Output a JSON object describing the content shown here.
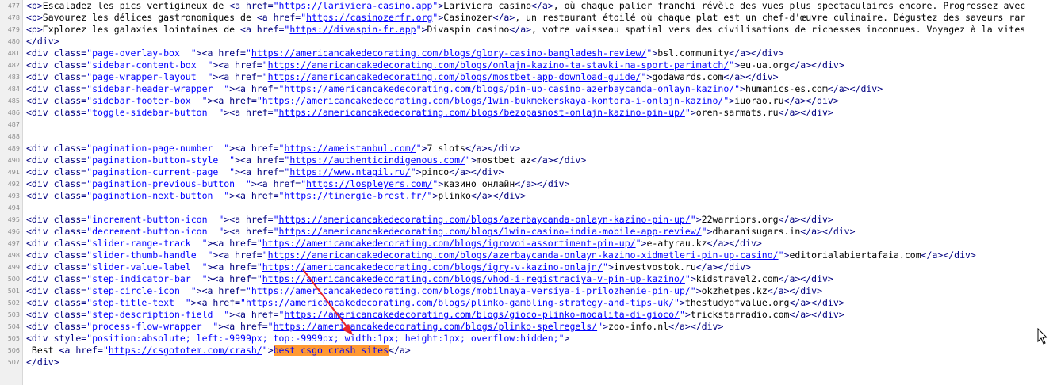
{
  "colors": {
    "tag": "#000080",
    "value": "#0000ff",
    "highlight": "#ff9933",
    "arrow": "#e8242a"
  },
  "lines": [
    {
      "n": "477",
      "segs": [
        [
          "t",
          "<p>"
        ],
        [
          "p",
          "Escaladez les pics vertigineux de "
        ],
        [
          "t",
          "<a href="
        ],
        [
          "v",
          "\""
        ],
        [
          "u",
          "https://lariviera-casino.app"
        ],
        [
          "v",
          "\""
        ],
        [
          "t",
          ">"
        ],
        [
          "p",
          "Lariviera casino"
        ],
        [
          "t",
          "</a>"
        ],
        [
          "p",
          ", où chaque palier franchi révèle des vues plus spectaculaires encore. Progressez avec"
        ]
      ]
    },
    {
      "n": "478",
      "segs": [
        [
          "t",
          "<p>"
        ],
        [
          "p",
          "Savourez les délices gastronomiques de "
        ],
        [
          "t",
          "<a href="
        ],
        [
          "v",
          "\""
        ],
        [
          "u",
          "https://casinozerfr.org"
        ],
        [
          "v",
          "\""
        ],
        [
          "t",
          ">"
        ],
        [
          "p",
          "Casinozer"
        ],
        [
          "t",
          "</a>"
        ],
        [
          "p",
          ", un restaurant étoilé où chaque plat est un chef-d'œuvre culinaire. Dégustez des saveurs rar"
        ]
      ]
    },
    {
      "n": "479",
      "segs": [
        [
          "t",
          "<p>"
        ],
        [
          "p",
          "Explorez les galaxies lointaines de "
        ],
        [
          "t",
          "<a href="
        ],
        [
          "v",
          "\""
        ],
        [
          "u",
          "https://divaspin-fr.app"
        ],
        [
          "v",
          "\""
        ],
        [
          "t",
          ">"
        ],
        [
          "p",
          "Divaspin casino"
        ],
        [
          "t",
          "</a>"
        ],
        [
          "p",
          ", votre vaisseau spatial vers des civilisations de richesses inconnues. Voyagez à la vites"
        ]
      ]
    },
    {
      "n": "480",
      "segs": [
        [
          "t",
          "</div>"
        ]
      ]
    },
    {
      "n": "481",
      "segs": [
        [
          "t",
          "<div "
        ],
        [
          "a",
          "class="
        ],
        [
          "v",
          "\"page-overlay-box  \""
        ],
        [
          "t",
          "><a href="
        ],
        [
          "v",
          "\""
        ],
        [
          "u",
          "https://americancakedecorating.com/blogs/glory-casino-bangladesh-review/"
        ],
        [
          "v",
          "\""
        ],
        [
          "t",
          ">"
        ],
        [
          "p",
          "bsl.community"
        ],
        [
          "t",
          "</a></div>"
        ]
      ]
    },
    {
      "n": "482",
      "segs": [
        [
          "t",
          "<div "
        ],
        [
          "a",
          "class="
        ],
        [
          "v",
          "\"sidebar-content-box  \""
        ],
        [
          "t",
          "><a href="
        ],
        [
          "v",
          "\""
        ],
        [
          "u",
          "https://americancakedecorating.com/blogs/onlajn-kazino-ta-stavki-na-sport-parimatch/"
        ],
        [
          "v",
          "\""
        ],
        [
          "t",
          ">"
        ],
        [
          "p",
          "eu-ua.org"
        ],
        [
          "t",
          "</a></div>"
        ]
      ]
    },
    {
      "n": "483",
      "segs": [
        [
          "t",
          "<div "
        ],
        [
          "a",
          "class="
        ],
        [
          "v",
          "\"page-wrapper-layout  \""
        ],
        [
          "t",
          "><a href="
        ],
        [
          "v",
          "\""
        ],
        [
          "u",
          "https://americancakedecorating.com/blogs/mostbet-app-download-guide/"
        ],
        [
          "v",
          "\""
        ],
        [
          "t",
          ">"
        ],
        [
          "p",
          "godawards.com"
        ],
        [
          "t",
          "</a></div>"
        ]
      ]
    },
    {
      "n": "484",
      "segs": [
        [
          "t",
          "<div "
        ],
        [
          "a",
          "class="
        ],
        [
          "v",
          "\"sidebar-header-wrapper  \""
        ],
        [
          "t",
          "><a href="
        ],
        [
          "v",
          "\""
        ],
        [
          "u",
          "https://americancakedecorating.com/blogs/pin-up-casino-azerbaycanda-onlayn-kazino/"
        ],
        [
          "v",
          "\""
        ],
        [
          "t",
          ">"
        ],
        [
          "p",
          "humanics-es.com"
        ],
        [
          "t",
          "</a></div>"
        ]
      ]
    },
    {
      "n": "485",
      "segs": [
        [
          "t",
          "<div "
        ],
        [
          "a",
          "class="
        ],
        [
          "v",
          "\"sidebar-footer-box  \""
        ],
        [
          "t",
          "><a href="
        ],
        [
          "v",
          "\""
        ],
        [
          "u",
          "https://americancakedecorating.com/blogs/1win-bukmekerskaya-kontora-i-onlajn-kazino/"
        ],
        [
          "v",
          "\""
        ],
        [
          "t",
          ">"
        ],
        [
          "p",
          "iuorao.ru"
        ],
        [
          "t",
          "</a></div>"
        ]
      ]
    },
    {
      "n": "486",
      "segs": [
        [
          "t",
          "<div "
        ],
        [
          "a",
          "class="
        ],
        [
          "v",
          "\"toggle-sidebar-button  \""
        ],
        [
          "t",
          "><a href="
        ],
        [
          "v",
          "\""
        ],
        [
          "u",
          "https://americancakedecorating.com/blogs/bezopasnost-onlajn-kazino-pin-up/"
        ],
        [
          "v",
          "\""
        ],
        [
          "t",
          ">"
        ],
        [
          "p",
          "oren-sarmats.ru"
        ],
        [
          "t",
          "</a></div>"
        ]
      ]
    },
    {
      "n": "487",
      "segs": []
    },
    {
      "n": "488",
      "segs": []
    },
    {
      "n": "489",
      "segs": [
        [
          "t",
          "<div "
        ],
        [
          "a",
          "class="
        ],
        [
          "v",
          "\"pagination-page-number  \""
        ],
        [
          "t",
          "><a href="
        ],
        [
          "v",
          "\""
        ],
        [
          "u",
          "https://ameistanbul.com/"
        ],
        [
          "v",
          "\""
        ],
        [
          "t",
          ">"
        ],
        [
          "p",
          "7 slots"
        ],
        [
          "t",
          "</a></div>"
        ]
      ]
    },
    {
      "n": "490",
      "segs": [
        [
          "t",
          "<div "
        ],
        [
          "a",
          "class="
        ],
        [
          "v",
          "\"pagination-button-style  \""
        ],
        [
          "t",
          "><a href="
        ],
        [
          "v",
          "\""
        ],
        [
          "u",
          "https://authenticindigenous.com/"
        ],
        [
          "v",
          "\""
        ],
        [
          "t",
          ">"
        ],
        [
          "p",
          "mostbet az"
        ],
        [
          "t",
          "</a></div>"
        ]
      ]
    },
    {
      "n": "491",
      "segs": [
        [
          "t",
          "<div "
        ],
        [
          "a",
          "class="
        ],
        [
          "v",
          "\"pagination-current-page  \""
        ],
        [
          "t",
          "><a href="
        ],
        [
          "v",
          "\""
        ],
        [
          "u",
          "https://www.ntagil.ru/"
        ],
        [
          "v",
          "\""
        ],
        [
          "t",
          ">"
        ],
        [
          "p",
          "pinco"
        ],
        [
          "t",
          "</a></div>"
        ]
      ]
    },
    {
      "n": "492",
      "segs": [
        [
          "t",
          "<div "
        ],
        [
          "a",
          "class="
        ],
        [
          "v",
          "\"pagination-previous-button  \""
        ],
        [
          "t",
          "><a href="
        ],
        [
          "v",
          "\""
        ],
        [
          "u",
          "https://lospleyers.com/"
        ],
        [
          "v",
          "\""
        ],
        [
          "t",
          ">"
        ],
        [
          "p",
          "казино онлайн"
        ],
        [
          "t",
          "</a></div>"
        ]
      ]
    },
    {
      "n": "493",
      "segs": [
        [
          "t",
          "<div "
        ],
        [
          "a",
          "class="
        ],
        [
          "v",
          "\"pagination-next-button  \""
        ],
        [
          "t",
          "><a href="
        ],
        [
          "v",
          "\""
        ],
        [
          "u",
          "https://tinergie-brest.fr/"
        ],
        [
          "v",
          "\""
        ],
        [
          "t",
          ">"
        ],
        [
          "p",
          "plinko"
        ],
        [
          "t",
          "</a></div>"
        ]
      ]
    },
    {
      "n": "494",
      "segs": []
    },
    {
      "n": "495",
      "segs": [
        [
          "t",
          "<div "
        ],
        [
          "a",
          "class="
        ],
        [
          "v",
          "\"increment-button-icon  \""
        ],
        [
          "t",
          "><a href="
        ],
        [
          "v",
          "\""
        ],
        [
          "u",
          "https://americancakedecorating.com/blogs/azerbaycanda-onlayn-kazino-pin-up/"
        ],
        [
          "v",
          "\""
        ],
        [
          "t",
          ">"
        ],
        [
          "p",
          "22warriors.org"
        ],
        [
          "t",
          "</a></div>"
        ]
      ]
    },
    {
      "n": "496",
      "segs": [
        [
          "t",
          "<div "
        ],
        [
          "a",
          "class="
        ],
        [
          "v",
          "\"decrement-button-icon  \""
        ],
        [
          "t",
          "><a href="
        ],
        [
          "v",
          "\""
        ],
        [
          "u",
          "https://americancakedecorating.com/blogs/1win-casino-india-mobile-app-review/"
        ],
        [
          "v",
          "\""
        ],
        [
          "t",
          ">"
        ],
        [
          "p",
          "dharanisugars.in"
        ],
        [
          "t",
          "</a></div>"
        ]
      ]
    },
    {
      "n": "497",
      "segs": [
        [
          "t",
          "<div "
        ],
        [
          "a",
          "class="
        ],
        [
          "v",
          "\"slider-range-track  \""
        ],
        [
          "t",
          "><a href="
        ],
        [
          "v",
          "\""
        ],
        [
          "u",
          "https://americancakedecorating.com/blogs/igrovoi-assortiment-pin-up/"
        ],
        [
          "v",
          "\""
        ],
        [
          "t",
          ">"
        ],
        [
          "p",
          "e-atyrau.kz"
        ],
        [
          "t",
          "</a></div>"
        ]
      ]
    },
    {
      "n": "498",
      "segs": [
        [
          "t",
          "<div "
        ],
        [
          "a",
          "class="
        ],
        [
          "v",
          "\"slider-thumb-handle  \""
        ],
        [
          "t",
          "><a href="
        ],
        [
          "v",
          "\""
        ],
        [
          "u",
          "https://americancakedecorating.com/blogs/azerbaycanda-onlayn-kazino-xidmetleri-pin-up-casino/"
        ],
        [
          "v",
          "\""
        ],
        [
          "t",
          ">"
        ],
        [
          "p",
          "editorialabiertafaia.com"
        ],
        [
          "t",
          "</a></div>"
        ]
      ]
    },
    {
      "n": "499",
      "segs": [
        [
          "t",
          "<div "
        ],
        [
          "a",
          "class="
        ],
        [
          "v",
          "\"slider-value-label  \""
        ],
        [
          "t",
          "><a href="
        ],
        [
          "v",
          "\""
        ],
        [
          "u",
          "https://americancakedecorating.com/blogs/igry-v-kazino-onlajn/"
        ],
        [
          "v",
          "\""
        ],
        [
          "t",
          ">"
        ],
        [
          "p",
          "investvostok.ru"
        ],
        [
          "t",
          "</a></div>"
        ]
      ]
    },
    {
      "n": "500",
      "segs": [
        [
          "t",
          "<div "
        ],
        [
          "a",
          "class="
        ],
        [
          "v",
          "\"step-indicator-bar  \""
        ],
        [
          "t",
          "><a href="
        ],
        [
          "v",
          "\""
        ],
        [
          "u",
          "https://americancakedecorating.com/blogs/vhod-i-registraciya-v-pin-up-kazino/"
        ],
        [
          "v",
          "\""
        ],
        [
          "t",
          ">"
        ],
        [
          "p",
          "kidstravel2.com"
        ],
        [
          "t",
          "</a></div>"
        ]
      ]
    },
    {
      "n": "501",
      "segs": [
        [
          "t",
          "<div "
        ],
        [
          "a",
          "class="
        ],
        [
          "v",
          "\"step-circle-icon  \""
        ],
        [
          "t",
          "><a href="
        ],
        [
          "v",
          "\""
        ],
        [
          "u",
          "https://americancakedecorating.com/blogs/mobilnaya-versiya-i-prilozhenie-pin-up/"
        ],
        [
          "v",
          "\""
        ],
        [
          "t",
          ">"
        ],
        [
          "p",
          "okzhetpes.kz"
        ],
        [
          "t",
          "</a></div>"
        ]
      ]
    },
    {
      "n": "502",
      "segs": [
        [
          "t",
          "<div "
        ],
        [
          "a",
          "class="
        ],
        [
          "v",
          "\"step-title-text  \""
        ],
        [
          "t",
          "><a href="
        ],
        [
          "v",
          "\""
        ],
        [
          "u",
          "https://americancakedecorating.com/blogs/plinko-gambling-strategy-and-tips-uk/"
        ],
        [
          "v",
          "\""
        ],
        [
          "t",
          ">"
        ],
        [
          "p",
          "thestudyofvalue.org"
        ],
        [
          "t",
          "</a></div>"
        ]
      ]
    },
    {
      "n": "503",
      "segs": [
        [
          "t",
          "<div "
        ],
        [
          "a",
          "class="
        ],
        [
          "v",
          "\"step-description-field  \""
        ],
        [
          "t",
          "><a href="
        ],
        [
          "v",
          "\""
        ],
        [
          "u",
          "https://americancakedecorating.com/blogs/gioco-plinko-modalita-di-gioco/"
        ],
        [
          "v",
          "\""
        ],
        [
          "t",
          ">"
        ],
        [
          "p",
          "trickstarradio.com"
        ],
        [
          "t",
          "</a></div>"
        ]
      ]
    },
    {
      "n": "504",
      "segs": [
        [
          "t",
          "<div "
        ],
        [
          "a",
          "class="
        ],
        [
          "v",
          "\"process-flow-wrapper  \""
        ],
        [
          "t",
          "><a href="
        ],
        [
          "v",
          "\""
        ],
        [
          "u",
          "https://americancakedecorating.com/blogs/plinko-spelregels/"
        ],
        [
          "v",
          "\""
        ],
        [
          "t",
          ">"
        ],
        [
          "p",
          "zoo-info.nl"
        ],
        [
          "t",
          "</a></div>"
        ]
      ]
    },
    {
      "n": "505",
      "segs": [
        [
          "t",
          "<div "
        ],
        [
          "a",
          "style="
        ],
        [
          "v",
          "\"position:absolute; left:-9999px; top:-9999px; width:1px; height:1px; overflow:hidden;\""
        ],
        [
          "t",
          ">"
        ]
      ]
    },
    {
      "n": "506",
      "segs": [
        [
          "p",
          " Best "
        ],
        [
          "t",
          "<a href="
        ],
        [
          "v",
          "\""
        ],
        [
          "u",
          "https://csgototem.com/crash/"
        ],
        [
          "v",
          "\""
        ],
        [
          "t",
          ">"
        ],
        [
          "h",
          "best csgo crash sites"
        ],
        [
          "t",
          "</a>"
        ]
      ]
    },
    {
      "n": "507",
      "segs": [
        [
          "t",
          "</div>"
        ]
      ]
    }
  ]
}
